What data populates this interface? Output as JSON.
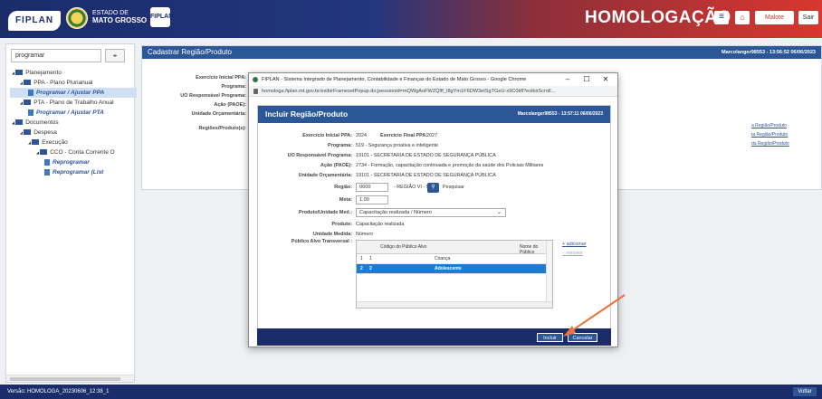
{
  "header": {
    "logo": "FIPLAN",
    "state_small": "ESTADO DE",
    "state": "MATO GROSSO",
    "app_icon": "FIPLAN",
    "env": "HOMOLOGAÇÃO",
    "menu_icon": "≡",
    "home_icon": "⌂",
    "malote": "Malote",
    "sair": "Sair"
  },
  "sidebar": {
    "search_value": "programar",
    "search_button": "⌖",
    "tree": [
      {
        "label": "Planejamento",
        "type": "folder",
        "indent": 0
      },
      {
        "label": "PPA - Plano Plurianual",
        "type": "folder",
        "indent": 1
      },
      {
        "label": "Programar / Ajustar PPA",
        "type": "link",
        "indent": 2,
        "selected": true
      },
      {
        "label": "PTA - Plano de Trabalho Anual",
        "type": "folder",
        "indent": 1
      },
      {
        "label": "Programar / Ajustar PTA",
        "type": "link",
        "indent": 2
      },
      {
        "label": "Documentos",
        "type": "folder",
        "indent": 0
      },
      {
        "label": "Despesa",
        "type": "folder",
        "indent": 1
      },
      {
        "label": "Execução",
        "type": "folder",
        "indent": 2
      },
      {
        "label": "CCO - Conta Corrente O",
        "type": "folder",
        "indent": 3
      },
      {
        "label": "Reprogramar",
        "type": "link",
        "indent": 4
      },
      {
        "label": "Reprogramar (List",
        "type": "link",
        "indent": 4
      }
    ]
  },
  "main": {
    "title": "Cadastrar Região/Produto",
    "user": "Marcolanger98553 - 13:56:52 06/06/2023",
    "labels": [
      "Exercício Inicial PPA:",
      "Programa:",
      "UO Responsável Programa:",
      "Ação (PAOE):",
      "Unidade Orçamentária:",
      "Regiões/Produto(s):"
    ],
    "links": [
      "a Região/Produto",
      "ta Região/Produto",
      "da Região/Produto"
    ]
  },
  "chrome": {
    "title": "FIPLAN - Sistema Integrado de Planejamento, Contabilidade e Finanças do Estado de Mato Grosso - Google Chrome",
    "url": "homologa.fiplan.mt.gov.br/exibirFramesetPopup.do;jsessionid=mQWgAoFWZQlff_I8gYm1F6DW3etSgTGeU-x9C0kfl?exibirScroll...",
    "min": "–",
    "max": "☐",
    "close": "✕"
  },
  "dialog": {
    "title": "Incluir Região/Produto",
    "user": "Marcolanger98553 - 13:57:11 06/06/2023",
    "exercicio_label": "Exercício Inicial PPA:",
    "exercicio_value": "2024",
    "exercicio_final_label": "Exercício Final PPA:",
    "exercicio_final_value": "2027",
    "programa_label": "Programa:",
    "programa_value": "519 -  Segurança proativa e inteligente",
    "uo_label": "UO Responsável Programa:",
    "uo_value": "19101 -  SECRETARIA DE ESTADO DE SEGURANÇA PÚBLICA",
    "acao_label": "Ação (PAOE):",
    "acao_value": "2734 -  Formação, capacitação continuada e promoção da saúde dos Policiais Militares",
    "unidade_label": "Unidade Orçamentária:",
    "unidade_value": "19101 -  SECRETARIA DE ESTADO DE SEGURANÇA PÚBLICA",
    "regiao_label": "Região:",
    "regiao_value": "0600",
    "regiao_desc": "- REGIÃO VI - SUL",
    "pesquisar": "Pesquisar",
    "meta_label": "Meta:",
    "meta_value": "1,00",
    "produto_label": "Produto/Unidade Med.:",
    "produto_select": "Capacitação realizada / Número",
    "produto2_label": "Produto:",
    "produto2_value": "Capacitação realizada",
    "unidade_medida_label": "Unidade Medida:",
    "unidade_medida_value": "Número",
    "publico_label": "Público Alvo Transversal :",
    "grid_headers": [
      "Código do Público Alvo",
      "Nome do Público"
    ],
    "grid_rows": [
      {
        "n": "1",
        "codigo": "1",
        "nome": "Criança"
      },
      {
        "n": "2",
        "codigo": "2",
        "nome": "Adolescente"
      }
    ],
    "adicionar": "adicionar",
    "remover": "remover",
    "incluir": "Incluir",
    "cancelar": "Cancelar"
  },
  "footer": {
    "version": "Versão: HOMOLOGA_20230606_12:38_1",
    "voltar": "Voltar"
  },
  "colors": {
    "primary": "#2b5797",
    "header_dark": "#1b2c6b",
    "header_red": "#d9362e",
    "selection": "#1f7bd1",
    "arrow": "#e8743b"
  }
}
